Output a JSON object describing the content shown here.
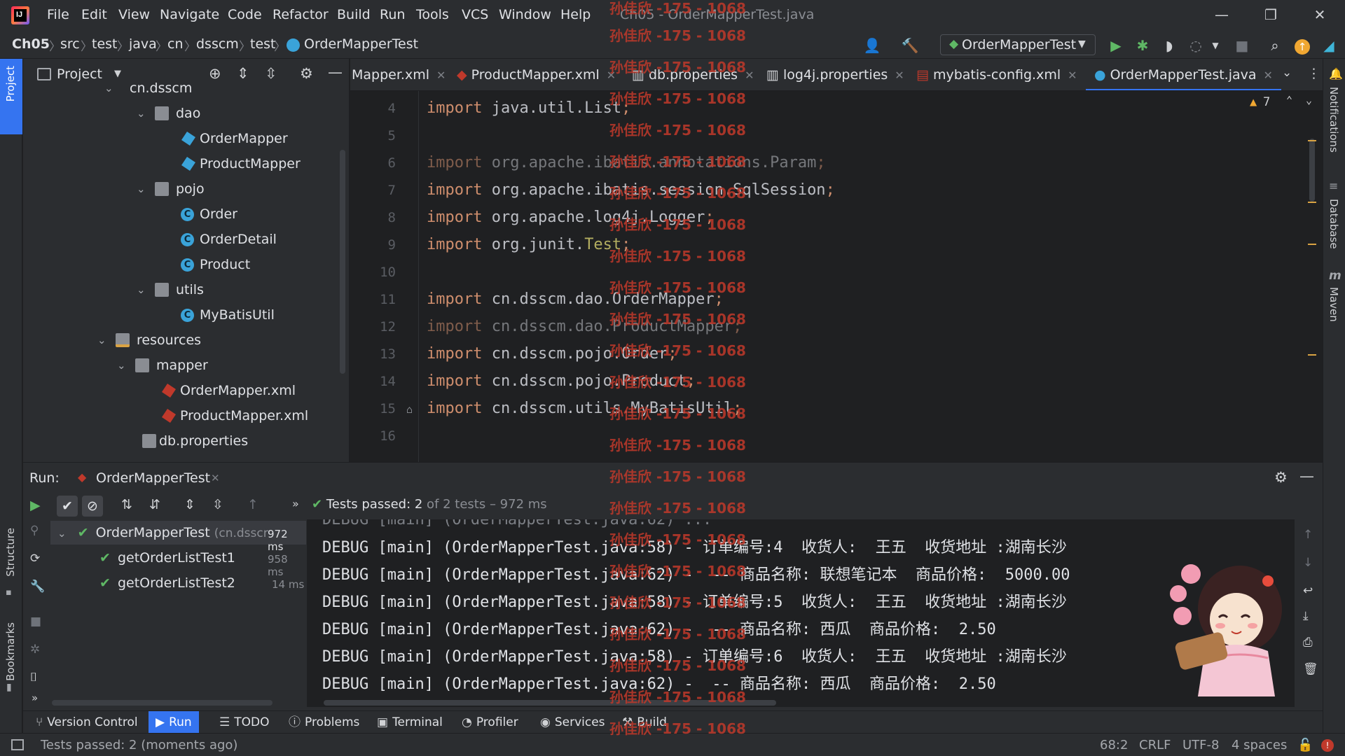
{
  "titlebar": {
    "menu": [
      "File",
      "Edit",
      "View",
      "Navigate",
      "Code",
      "Refactor",
      "Build",
      "Run",
      "Tools",
      "VCS",
      "Window",
      "Help"
    ],
    "window_title": "Ch05 - OrderMapperTest.java",
    "minimize": "—",
    "restore": "❐",
    "close": "✕"
  },
  "breadcrumb": [
    "Ch05",
    "src",
    "test",
    "java",
    "cn",
    "dsscm",
    "test",
    "OrderMapperTest"
  ],
  "run_config": "OrderMapperTest",
  "project": {
    "title": "Project",
    "tree": [
      {
        "label": "cn.dsscm",
        "type": "package",
        "indent": 0
      },
      {
        "label": "dao",
        "type": "folder",
        "indent": 1,
        "expanded": true
      },
      {
        "label": "OrderMapper",
        "type": "mapper",
        "indent": 2
      },
      {
        "label": "ProductMapper",
        "type": "mapper",
        "indent": 2
      },
      {
        "label": "pojo",
        "type": "folder",
        "indent": 1,
        "expanded": true
      },
      {
        "label": "Order",
        "type": "class",
        "indent": 2
      },
      {
        "label": "OrderDetail",
        "type": "class",
        "indent": 2
      },
      {
        "label": "Product",
        "type": "class",
        "indent": 2
      },
      {
        "label": "utils",
        "type": "folder",
        "indent": 1,
        "expanded": true
      },
      {
        "label": "MyBatisUtil",
        "type": "class",
        "indent": 2
      },
      {
        "label": "resources",
        "type": "resfolder",
        "indent": -1,
        "expanded": true
      },
      {
        "label": "mapper",
        "type": "folder",
        "indent": 0,
        "expanded": true
      },
      {
        "label": "OrderMapper.xml",
        "type": "xml",
        "indent": 1
      },
      {
        "label": "ProductMapper.xml",
        "type": "xml",
        "indent": 1
      },
      {
        "label": "db.properties",
        "type": "props",
        "indent": 0
      }
    ]
  },
  "editor": {
    "tabs": [
      {
        "label": "Mapper.xml",
        "active": false
      },
      {
        "label": "ProductMapper.xml",
        "active": false
      },
      {
        "label": "db.properties",
        "active": false
      },
      {
        "label": "log4j.properties",
        "active": false
      },
      {
        "label": "mybatis-config.xml",
        "active": false
      },
      {
        "label": "OrderMapperTest.java",
        "active": true
      }
    ],
    "warnings_count": "7",
    "line_numbers": [
      "4",
      "5",
      "6",
      "7",
      "8",
      "9",
      "10",
      "11",
      "12",
      "13",
      "14",
      "15",
      "16"
    ],
    "lines": [
      {
        "kw": "import",
        "rest": " java.util.List",
        "tail": ";",
        "style": "normal"
      },
      {
        "kw": "",
        "rest": "",
        "tail": "",
        "style": "normal"
      },
      {
        "kw": "import",
        "rest": " org.apache.ibatis.annotations.Param",
        "tail": ";",
        "style": "dim"
      },
      {
        "kw": "import",
        "rest": " org.apache.ibatis.session.SqlSession",
        "tail": ";",
        "style": "normal"
      },
      {
        "kw": "import",
        "rest": " org.apache.log4j.Logger",
        "tail": ";",
        "style": "normal"
      },
      {
        "kw": "import",
        "rest": " org.junit.",
        "ann": "Test",
        "tail": ";",
        "style": "normal"
      },
      {
        "kw": "",
        "rest": "",
        "tail": "",
        "style": "normal"
      },
      {
        "kw": "import",
        "rest": " cn.dsscm.dao.OrderMapper",
        "tail": ";",
        "style": "normal"
      },
      {
        "kw": "import",
        "rest": " cn.dsscm.dao.ProductMapper",
        "tail": ";",
        "style": "dim"
      },
      {
        "kw": "import",
        "rest": " cn.dsscm.pojo.Order",
        "tail": ";",
        "style": "normal"
      },
      {
        "kw": "import",
        "rest": " cn.dsscm.pojo.Product",
        "tail": ";",
        "style": "normal"
      },
      {
        "kw": "import",
        "rest": " cn.dsscm.utils.MyBatisUtil",
        "tail": ";",
        "style": "normal"
      },
      {
        "kw": "",
        "rest": "",
        "tail": "",
        "style": "normal"
      }
    ]
  },
  "run": {
    "label": "Run:",
    "tab": "OrderMapperTest",
    "status_bold": "Tests passed: 2",
    "status_rest": " of 2 tests – 972 ms",
    "tests": [
      {
        "label": "OrderMapperTest",
        "sub": "(cn.dsscr",
        "time": "972 ms",
        "level": 0
      },
      {
        "label": "getOrderListTest1",
        "sub": "",
        "time": "958 ms",
        "level": 1
      },
      {
        "label": "getOrderListTest2",
        "sub": "",
        "time": "14 ms",
        "level": 1
      }
    ],
    "console": [
      "DEBUG [main] (OrderMapperTest.java:58) - 订单编号:4  收货人:  王五  收货地址 :湖南长沙",
      "DEBUG [main] (OrderMapperTest.java:62) -  -- 商品名称: 联想笔记本  商品价格:  5000.00",
      "DEBUG [main] (OrderMapperTest.java:58) - 订单编号:5  收货人:  王五  收货地址 :湖南长沙",
      "DEBUG [main] (OrderMapperTest.java:62) -  -- 商品名称: 西瓜  商品价格:  2.50",
      "DEBUG [main] (OrderMapperTest.java:58) - 订单编号:6  收货人:  王五  收货地址 :湖南长沙",
      "DEBUG [main] (OrderMapperTest.java:62) -  -- 商品名称: 西瓜  商品价格:  2.50"
    ]
  },
  "bottom_tools": [
    "Version Control",
    "Run",
    "TODO",
    "Problems",
    "Terminal",
    "Profiler",
    "Services",
    "Build"
  ],
  "left_strip": [
    "Project",
    "Structure",
    "Bookmarks"
  ],
  "right_strip": [
    "Notifications",
    "Database",
    "Maven"
  ],
  "statusbar": {
    "message": "Tests passed: 2 (moments ago)",
    "position": "68:2",
    "line_sep": "CRLF",
    "encoding": "UTF-8",
    "indent": "4 spaces"
  },
  "watermark": "孙佳欣 -175 - 1068",
  "colors": {
    "accent": "#3574f0",
    "pass": "#5fb865",
    "keyword": "#cf8e6d",
    "watermark": "#c0392b"
  }
}
